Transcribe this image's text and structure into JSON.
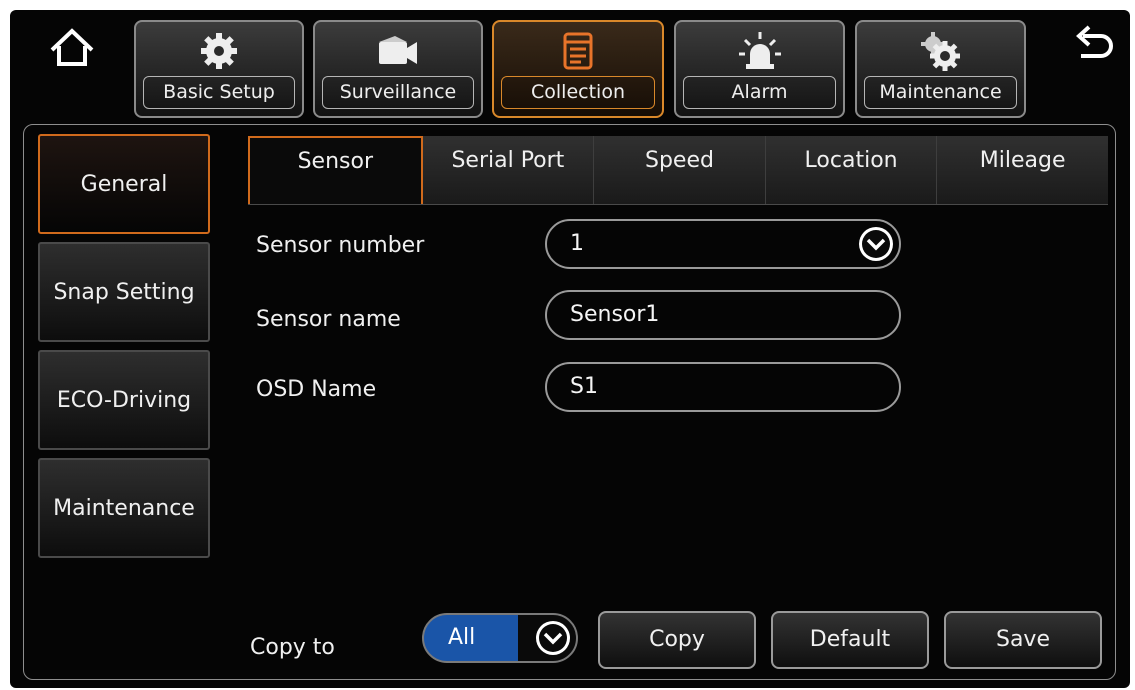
{
  "nav": {
    "tabs": [
      {
        "label": "Basic Setup",
        "icon": "gear-icon"
      },
      {
        "label": "Surveillance",
        "icon": "camera-icon"
      },
      {
        "label": "Collection",
        "icon": "collection-icon",
        "active": true
      },
      {
        "label": "Alarm",
        "icon": "alarm-light-icon"
      },
      {
        "label": "Maintenance",
        "icon": "gears-icon"
      }
    ]
  },
  "sidebar": {
    "items": [
      {
        "label": "General",
        "active": true
      },
      {
        "label": "Snap Setting"
      },
      {
        "label": "ECO-Driving"
      },
      {
        "label": "Maintenance"
      }
    ]
  },
  "subtabs": [
    {
      "label": "Sensor",
      "active": true
    },
    {
      "label": "Serial Port"
    },
    {
      "label": "Speed"
    },
    {
      "label": "Location"
    },
    {
      "label": "Mileage"
    }
  ],
  "form": {
    "sensor_number": {
      "label": "Sensor number",
      "value": "1"
    },
    "sensor_name": {
      "label": "Sensor name",
      "value": "Sensor1"
    },
    "osd_name": {
      "label": "OSD Name",
      "value": "S1"
    }
  },
  "footer": {
    "copy_to_label": "Copy to",
    "copy_to_value": "All",
    "copy_button": "Copy",
    "default_button": "Default",
    "save_button": "Save"
  },
  "colors": {
    "accent": "#d06a1c",
    "select_blue": "#1a55a8",
    "background": "#050505"
  }
}
